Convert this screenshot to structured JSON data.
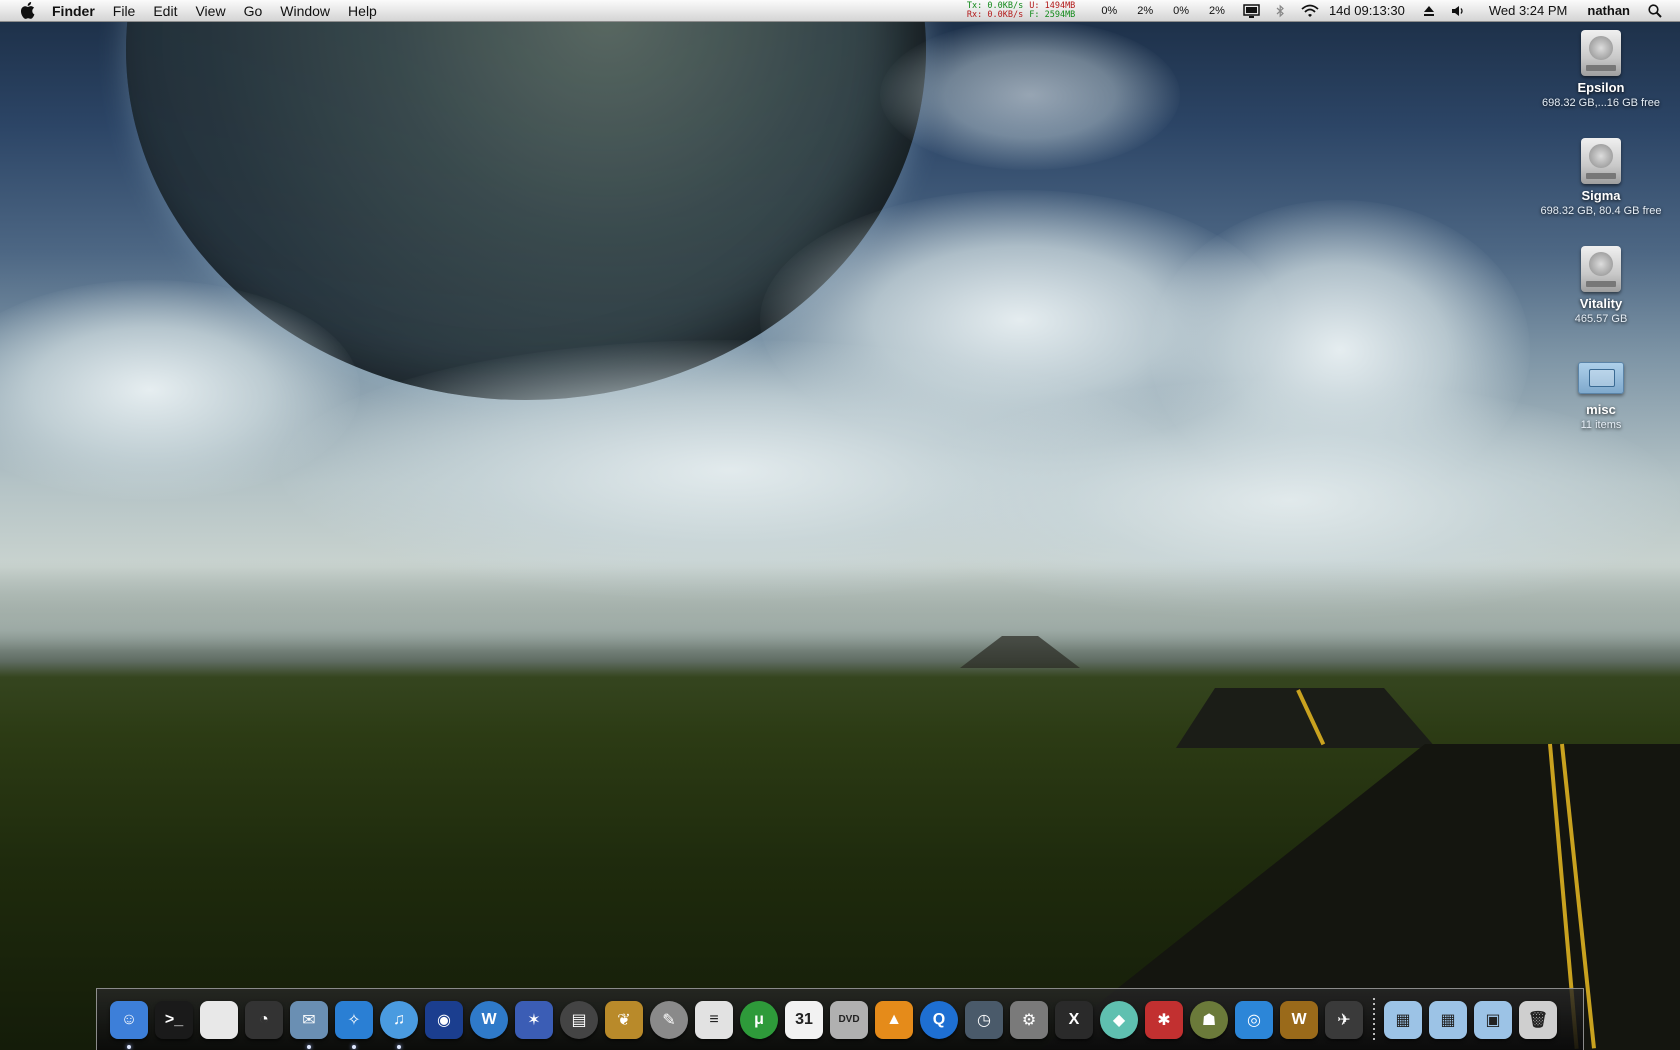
{
  "menubar": {
    "apple_icon": "apple-icon",
    "app_name": "Finder",
    "menus": [
      "File",
      "Edit",
      "View",
      "Go",
      "Window",
      "Help"
    ],
    "netstats": {
      "tx_label": "Tx:",
      "tx_value": "0.0KB/s",
      "rx_label": "Rx:",
      "rx_value": "0.0KB/s",
      "used_label": "U:",
      "used_value": "1494MB",
      "free_label": "F:",
      "free_value": "2594MB"
    },
    "cpu": [
      "0%",
      "2%",
      "0%",
      "2%"
    ],
    "uptime": "14d 09:13:30",
    "clock": "Wed 3:24 PM",
    "user": "nathan",
    "status_icons": [
      "display-icon",
      "bluetooth-icon",
      "wifi-icon",
      "eject-icon",
      "volume-icon",
      "spotlight-icon"
    ]
  },
  "desktop_icons": [
    {
      "name": "Epsilon",
      "sub": "698.32 GB,...16 GB free",
      "kind": "drive"
    },
    {
      "name": "Sigma",
      "sub": "698.32 GB, 80.4 GB free",
      "kind": "drive"
    },
    {
      "name": "Vitality",
      "sub": "465.57 GB",
      "kind": "drive"
    },
    {
      "name": "misc",
      "sub": "11 items",
      "kind": "folder"
    }
  ],
  "dock": {
    "apps": [
      {
        "icon": "finder-icon",
        "bg": "#3d7fd9",
        "glyph": "☺",
        "running": true
      },
      {
        "icon": "terminal-icon",
        "bg": "#1a1a1a",
        "glyph": ">_",
        "running": false
      },
      {
        "icon": "mouse-icon",
        "bg": "#e8e8e8",
        "glyph": "",
        "running": false
      },
      {
        "icon": "activity-monitor-icon",
        "bg": "#333333",
        "glyph": "◔",
        "running": false
      },
      {
        "icon": "mail-icon",
        "bg": "#6a8fb3",
        "glyph": "✉",
        "running": true
      },
      {
        "icon": "safari-icon",
        "bg": "#2a7fd4",
        "glyph": "✧",
        "running": true
      },
      {
        "icon": "itunes-icon",
        "bg": "#4a9be0",
        "glyph": "♫",
        "running": true
      },
      {
        "icon": "app-icon",
        "bg": "#1b3e8f",
        "glyph": "◉",
        "running": false
      },
      {
        "icon": "app-icon",
        "bg": "#2f7ac9",
        "glyph": "W",
        "running": false
      },
      {
        "icon": "imovie-icon",
        "bg": "#3b5db5",
        "glyph": "✶",
        "running": false
      },
      {
        "icon": "app-icon",
        "bg": "#444444",
        "glyph": "▤",
        "running": false
      },
      {
        "icon": "app-icon",
        "bg": "#b98a2a",
        "glyph": "❦",
        "running": false
      },
      {
        "icon": "app-icon",
        "bg": "#8a8a8a",
        "glyph": "✎",
        "running": false
      },
      {
        "icon": "textedit-icon",
        "bg": "#e2e2e2",
        "glyph": "≡",
        "running": false
      },
      {
        "icon": "utorrent-icon",
        "bg": "#2e9a3a",
        "glyph": "μ",
        "running": false
      },
      {
        "icon": "ical-icon",
        "bg": "#f2f2f2",
        "glyph": "31",
        "running": false
      },
      {
        "icon": "dvd-player-icon",
        "bg": "#b0b0b0",
        "glyph": "DVD",
        "running": false
      },
      {
        "icon": "vlc-icon",
        "bg": "#e58b1a",
        "glyph": "▲",
        "running": false
      },
      {
        "icon": "quicktime-icon",
        "bg": "#1e6fd2",
        "glyph": "Q",
        "running": false
      },
      {
        "icon": "time-machine-icon",
        "bg": "#4a5a6a",
        "glyph": "◷",
        "running": false
      },
      {
        "icon": "system-preferences-icon",
        "bg": "#7a7a7a",
        "glyph": "⚙",
        "running": false
      },
      {
        "icon": "x11-icon",
        "bg": "#2a2a2a",
        "glyph": "X",
        "running": false
      },
      {
        "icon": "app-icon",
        "bg": "#5fc0b0",
        "glyph": "◆",
        "running": false
      },
      {
        "icon": "app-icon",
        "bg": "#c23030",
        "glyph": "✱",
        "running": false
      },
      {
        "icon": "app-icon",
        "bg": "#6b7a3a",
        "glyph": "☗",
        "running": false
      },
      {
        "icon": "app-icon",
        "bg": "#2c86d8",
        "glyph": "◎",
        "running": false
      },
      {
        "icon": "world-of-warcraft-icon",
        "bg": "#9a6a1a",
        "glyph": "W",
        "running": false
      },
      {
        "icon": "app-icon",
        "bg": "#3a3a3a",
        "glyph": "✈",
        "running": false
      }
    ],
    "stacks": [
      {
        "icon": "folder-stack-icon",
        "bg": "#9cc3e6",
        "glyph": "▦"
      },
      {
        "icon": "folder-stack-icon",
        "bg": "#9cc3e6",
        "glyph": "▦"
      },
      {
        "icon": "folder-stack-icon",
        "bg": "#9cc3e6",
        "glyph": "▣"
      },
      {
        "icon": "trash-icon",
        "bg": "#cfcfcf",
        "glyph": "🗑"
      }
    ]
  }
}
